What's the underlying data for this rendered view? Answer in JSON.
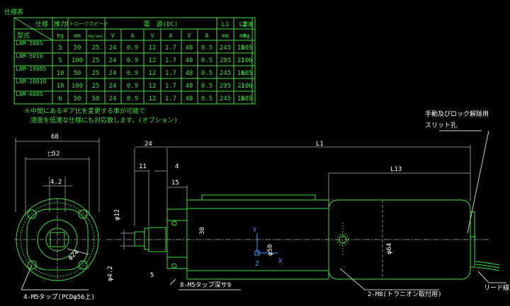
{
  "spec_table": {
    "title": "仕様表",
    "header_corner_top": "仕様",
    "header_corner_bottom": "型式",
    "col_thrust": "推力",
    "col_stroke_speed": "ストロークスピード",
    "col_power": "電　源(DC)",
    "col_l1": "L1",
    "col_l2": "L2",
    "col_weight": "重量",
    "units": [
      "kg",
      "mm",
      "mm/sec",
      "V",
      "A",
      "V",
      "A",
      "V",
      "A",
      "mm",
      "mm",
      "Kg"
    ],
    "rows": [
      {
        "model": "LAM-5005",
        "cells": [
          "5",
          "50",
          "25",
          "24",
          "0.9",
          "12",
          "1.7",
          "48",
          "0.5",
          "245",
          "160",
          "1.5"
        ]
      },
      {
        "model": "LAM-5010",
        "cells": [
          "5",
          "100",
          "25",
          "24",
          "0.9",
          "12",
          "1.7",
          "48",
          "0.5",
          "295",
          "210",
          "1.6"
        ]
      },
      {
        "model": "LAM-10005",
        "cells": [
          "10",
          "50",
          "25",
          "24",
          "0.9",
          "12",
          "1.7",
          "48",
          "0.5",
          "245",
          "160",
          "1.5"
        ]
      },
      {
        "model": "LAM-10010",
        "cells": [
          "10",
          "100",
          "25",
          "24",
          "0.9",
          "12",
          "1.7",
          "48",
          "0.5",
          "295",
          "210",
          "1.6"
        ]
      },
      {
        "model": "LAM-6005",
        "cells": [
          "6",
          "50",
          "50",
          "24",
          "0.9",
          "12",
          "1.7",
          "48",
          "0.5",
          "245",
          "160",
          "1.5"
        ]
      }
    ],
    "note_line1": "※中間にあるギア比を変更する事が可能で",
    "note_line2": "　速度を低速な仕様にも対応致します。(オプション)"
  },
  "dims": {
    "d68": "68",
    "d52": "□52",
    "d4_2": "4.2",
    "d24": "φ24",
    "m5_tap": "4-M5タップ(PCDφ56上)",
    "d24_top": "24",
    "d11": "11",
    "d4": "4",
    "d15": "15",
    "l1": "L1",
    "l13": "L13",
    "d12": "φ12",
    "d4_2s": "φ4.2",
    "d5": "5",
    "d30": "30",
    "d50": "φ50",
    "d64": "φ64",
    "m5_depth": "8-M5タップ深サ9",
    "m8": "2-M8(トラニオン取付用)",
    "brake_title": "手動及びロック解除用",
    "slit": "スリット孔",
    "lead": "リード線"
  },
  "axes": {
    "y": "Y",
    "z": "Z",
    "x": "X"
  }
}
